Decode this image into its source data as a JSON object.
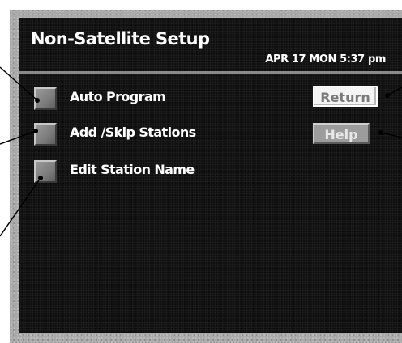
{
  "screen": {
    "title": "Non-Satellite Setup",
    "datetime": "APR 17 MON  5:37 pm"
  },
  "menu": {
    "items": [
      {
        "label": "Auto Program"
      },
      {
        "label": "Add /Skip Stations"
      },
      {
        "label": "Edit Station Name"
      }
    ]
  },
  "buttons": {
    "return_label": "Return",
    "help_label": "Help"
  },
  "colors": {
    "screen_background": "#111111",
    "bezel": "#a9a9a9",
    "text": "#ffffff",
    "button_gray": "#9c9c9c"
  }
}
